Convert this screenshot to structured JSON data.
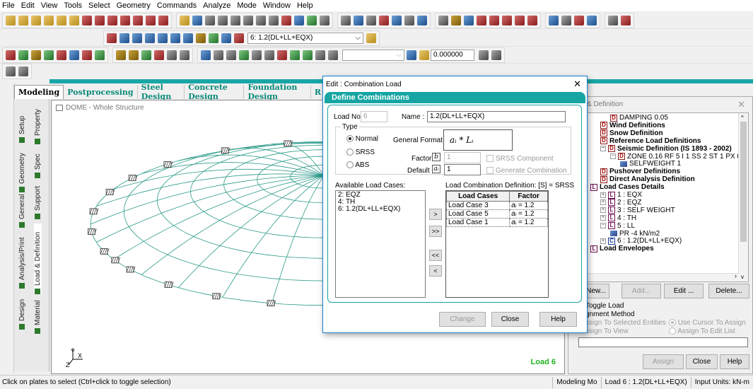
{
  "menu": [
    "File",
    "Edit",
    "View",
    "Tools",
    "Select",
    "Geometry",
    "Commands",
    "Analyze",
    "Mode",
    "Window",
    "Help"
  ],
  "toolbar": {
    "load_select": "6: 1.2(DL+LL+EQX)",
    "coord_value": "0.000000"
  },
  "page_tabs": [
    "Modeling",
    "Postprocessing",
    "Steel Design",
    "Concrete Design",
    "Foundation Design",
    "R"
  ],
  "vertical_tabs": [
    "Setup",
    "Geometry",
    "General",
    "Analysis/Print",
    "Design",
    "Property",
    "Spec",
    "Support",
    "Load & Definition",
    "Material"
  ],
  "viewport": {
    "title": "DOME - Whole Structure",
    "load_label": "Load 6",
    "axis_labels": [
      "Y",
      "X",
      "Z"
    ]
  },
  "right_panel": {
    "title": "& Definition",
    "tree": [
      {
        "label": "DAMPING 0.05",
        "bold": false,
        "icon": "D"
      },
      {
        "label": "Wind Definitions",
        "bold": true,
        "icon": "D"
      },
      {
        "label": "Snow Definition",
        "bold": true,
        "icon": "D"
      },
      {
        "label": "Reference Load Definitions",
        "bold": true,
        "icon": "D"
      },
      {
        "label": "Seismic Definition (IS 1893 - 2002)",
        "bold": true,
        "icon": "D"
      },
      {
        "label": "ZONE 0.16 RF 5 I 1 SS 2 ST 1 PX 0.5 PZ 0.",
        "bold": false,
        "icon": "D"
      },
      {
        "label": "SELFWEIGHT 1",
        "bold": false,
        "icon": ""
      },
      {
        "label": "Pushover Definitions",
        "bold": true,
        "icon": "D"
      },
      {
        "label": "Direct Analysis Definition",
        "bold": true,
        "icon": "D"
      },
      {
        "label": "Load Cases Details",
        "bold": true,
        "icon": "L"
      },
      {
        "label": "1 : EQX",
        "bold": false,
        "icon": "L"
      },
      {
        "label": "2 : EQZ",
        "bold": false,
        "icon": "L"
      },
      {
        "label": "3 : SELF WEIGHT",
        "bold": false,
        "icon": "L"
      },
      {
        "label": "4 : TH",
        "bold": false,
        "icon": "L"
      },
      {
        "label": "5 : LL",
        "bold": false,
        "icon": "L"
      },
      {
        "label": "PR -4 kN/m2",
        "bold": false,
        "icon": ""
      },
      {
        "label": "6 : 1.2(DL+LL+EQX)",
        "bold": false,
        "icon": "C"
      },
      {
        "label": "Load Envelopes",
        "bold": true,
        "icon": "L"
      }
    ],
    "buttons": {
      "new": "New...",
      "add": "Add...",
      "edit": "Edit ...",
      "delete": "Delete..."
    },
    "toggle_load": "Toggle Load",
    "assignment_method": "gnment Method",
    "assign_selected": "ssign To Selected Entities",
    "assign_view": "ssign To View",
    "use_cursor": "Use Cursor To Assign",
    "assign_edit": "Assign To Edit List",
    "assign_btn": "Assign",
    "close_btn": "Close",
    "help_btn": "Help"
  },
  "dialog": {
    "title": "Edit : Combination Load",
    "header": "Define Combinations",
    "load_no_label": "Load No:",
    "load_no": "6",
    "name_label": "Name :",
    "name": "1.2(DL+LL+EQX)",
    "type_label": "Type",
    "types": [
      "Normal",
      "SRSS",
      "ABS"
    ],
    "selected_type": "Normal",
    "general_format_label": "General Format :",
    "general_format": "aᵢ * Lᵢ",
    "factor_label": "Factor",
    "factor_symbol": "b",
    "factor_value": "1",
    "default_label": "Default",
    "default_symbol": "aᵢ",
    "default_value": "1",
    "srss_component": "SRSS Component",
    "generate_combination": "Generate Combination",
    "available_label": "Available Load Cases:",
    "available": [
      "2: EQZ",
      "4: TH",
      "6: 1.2(DL+LL+EQX)"
    ],
    "definition_label": "Load Combination Definition:  [S] = SRSS",
    "table_headers": [
      "Load Cases",
      "Factor"
    ],
    "combination": [
      {
        "case": "Load Case 3",
        "factor": "1.2"
      },
      {
        "case": "Load Case 5",
        "factor": "1.2"
      },
      {
        "case": "Load Case 1",
        "factor": "1.2"
      }
    ],
    "factor_prefix": "aᵢ =",
    "btn_add": ">",
    "btn_add_all": ">>",
    "btn_remove_all": "<<",
    "btn_remove": "<",
    "change": "Change",
    "close": "Close",
    "help": "Help"
  },
  "status": {
    "hint": "Click on plates to select (Ctrl+click to toggle selection)",
    "mode": "Modeling Mo",
    "load": "Load 6 : 1.2(DL+LL+EQX)",
    "units": "Input Units:  kN-m"
  },
  "colors": {
    "teal": "#16a5a3",
    "mesh": "#2a9a8a",
    "load_label": "#21b321"
  }
}
